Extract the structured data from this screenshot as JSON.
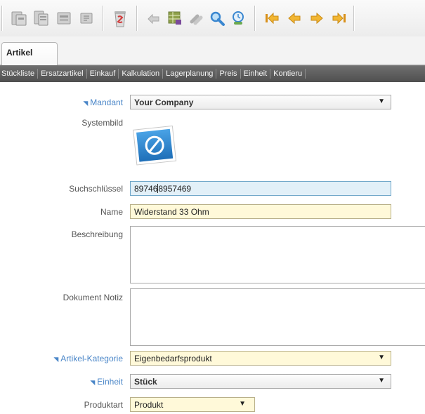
{
  "toolbar": {
    "buttons": [
      {
        "name": "save-icon",
        "color": "#9a9a9a"
      },
      {
        "name": "save-copy-icon",
        "color": "#9a9a9a"
      },
      {
        "name": "print-icon",
        "color": "#9a9a9a"
      },
      {
        "name": "attachment-icon",
        "color": "#9a9a9a"
      },
      {
        "name": "delete-icon",
        "color": "#d23b3b"
      },
      {
        "name": "undo-icon",
        "color": "#b0b0b0"
      },
      {
        "name": "grid-toggle-icon",
        "color": "#6b7d3a"
      },
      {
        "name": "link-icon",
        "color": "#b0b0b0"
      },
      {
        "name": "search-icon",
        "color": "#3a87d0"
      },
      {
        "name": "history-icon",
        "color": "#3a87d0"
      },
      {
        "name": "first-record-icon",
        "color": "#e0a020"
      },
      {
        "name": "previous-record-icon",
        "color": "#e0a020"
      },
      {
        "name": "next-record-icon",
        "color": "#e0a020"
      },
      {
        "name": "last-record-icon",
        "color": "#e0a020"
      }
    ]
  },
  "tabs": {
    "active": "Artikel"
  },
  "subnav": {
    "items": [
      "Stückliste",
      "Ersatzartikel",
      "Einkauf",
      "Kalkulation",
      "Lagerplanung",
      "Preis",
      "Einheit",
      "Kontieru"
    ]
  },
  "form": {
    "mandant": {
      "label": "Mandant",
      "value": "Your Company",
      "required": true
    },
    "systembild": {
      "label": "Systembild",
      "icon": "no-image-icon"
    },
    "suchschluessel": {
      "label": "Suchschlüssel",
      "value_before": "89746",
      "value_after": "8957469"
    },
    "name": {
      "label": "Name",
      "value": "Widerstand 33 Ohm"
    },
    "beschreibung": {
      "label": "Beschreibung",
      "value": ""
    },
    "dokument_notiz": {
      "label": "Dokument Notiz",
      "value": ""
    },
    "artikel_kategorie": {
      "label": "Artikel-Kategorie",
      "value": "Eigenbedarfsprodukt",
      "required": true
    },
    "einheit": {
      "label": "Einheit",
      "value": "Stück",
      "required": true
    },
    "produktart": {
      "label": "Produktart",
      "value": "Produkt"
    }
  },
  "colors": {
    "required_label": "#4a86c8",
    "mandatory_field_bg": "#fff9d9",
    "focused_field_bg": "#e2f0f8",
    "subnav_bg": "#5e5e5e"
  }
}
